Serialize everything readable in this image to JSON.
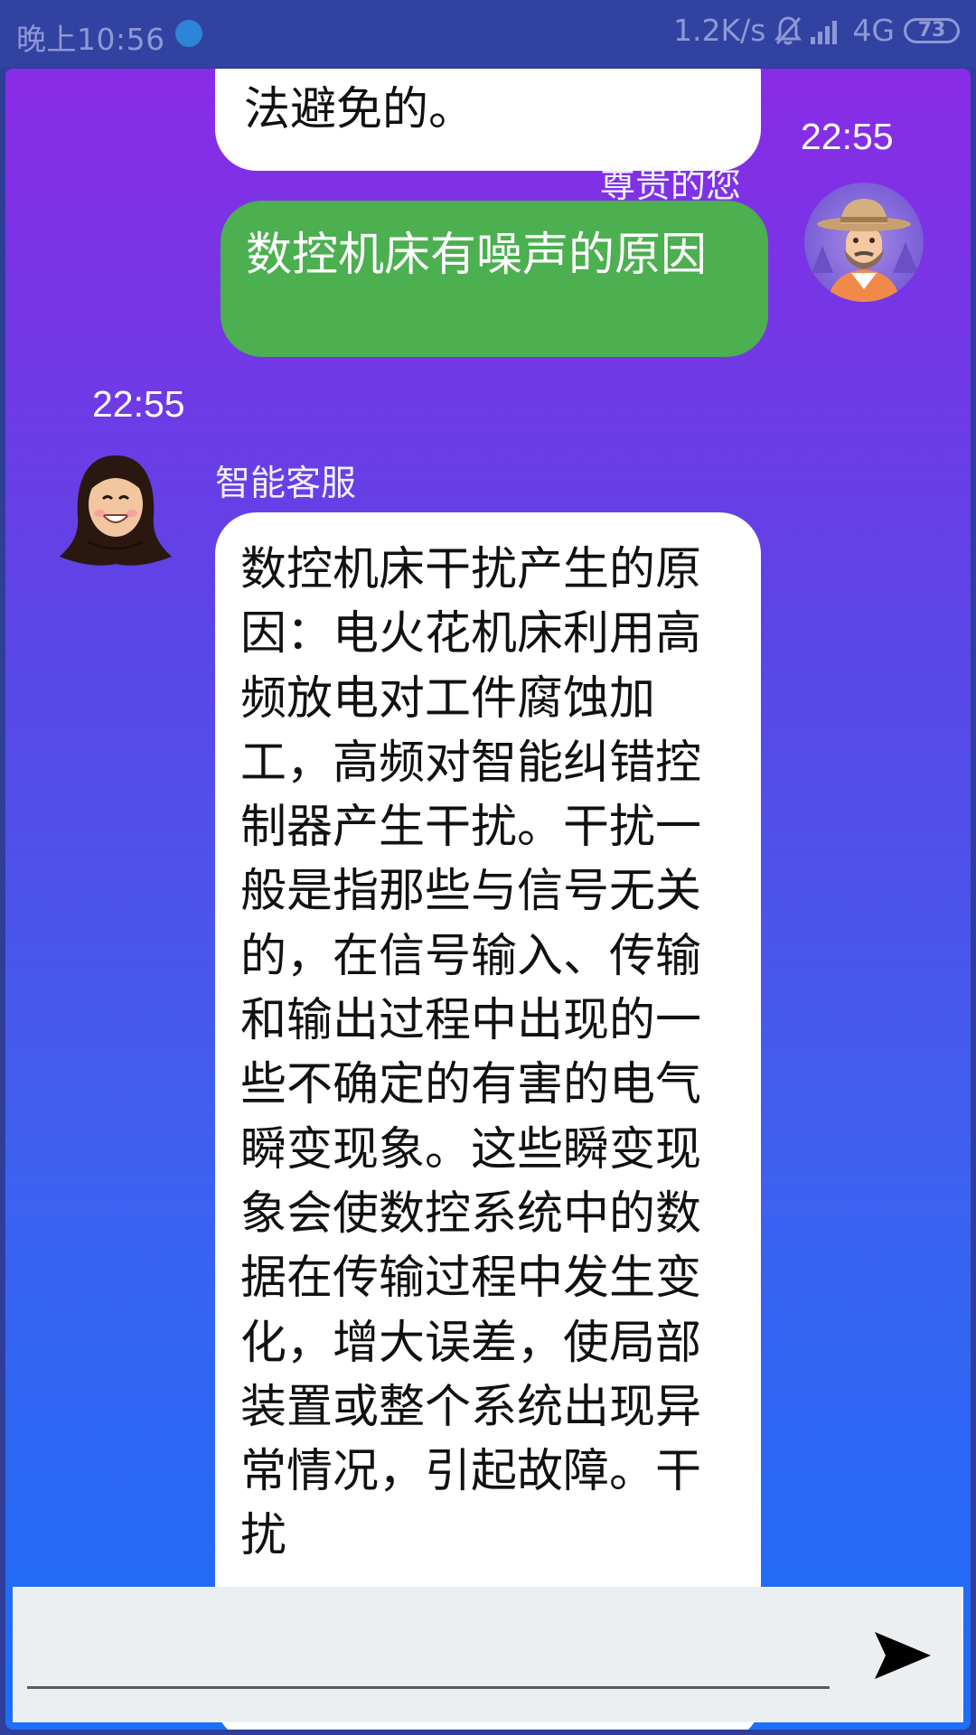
{
  "status_bar": {
    "time": "晚上10:56",
    "network_speed": "1.2K/s",
    "network_type": "4G",
    "battery": "73"
  },
  "messages": [
    {
      "sender": "智能客服",
      "role": "bot",
      "text": "法避免的。"
    },
    {
      "sender": "尊贵的您",
      "role": "user",
      "time": "22:55",
      "text": "数控机床有噪声的原因"
    },
    {
      "sender": "智能客服",
      "role": "bot",
      "time": "22:55",
      "text": " 数控机床干扰产生的原因：电火花机床利用高频放电对工件腐蚀加工，高频对智能纠错控制器产生干扰。干扰一般是指那些与信号无关的，在信号输入、传输和输出过程中出现的一些不确定的有害的电气瞬变现象。这些瞬变现象会使数控系统中的数据在传输过程中发生变化，增大误差，使局部装置或整个系统出现异常情况，引起故障。干扰"
    }
  ],
  "input": {
    "value": "",
    "placeholder": ""
  },
  "colors": {
    "gradient_top": "#8a2be6",
    "gradient_bottom": "#1b6ff8",
    "user_bubble": "#4caf50",
    "bot_bubble": "#ffffff",
    "status_bar": "#3242a0"
  },
  "icons": {
    "send": "send-icon",
    "mute": "bell-off-icon",
    "signal": "signal-icon"
  }
}
